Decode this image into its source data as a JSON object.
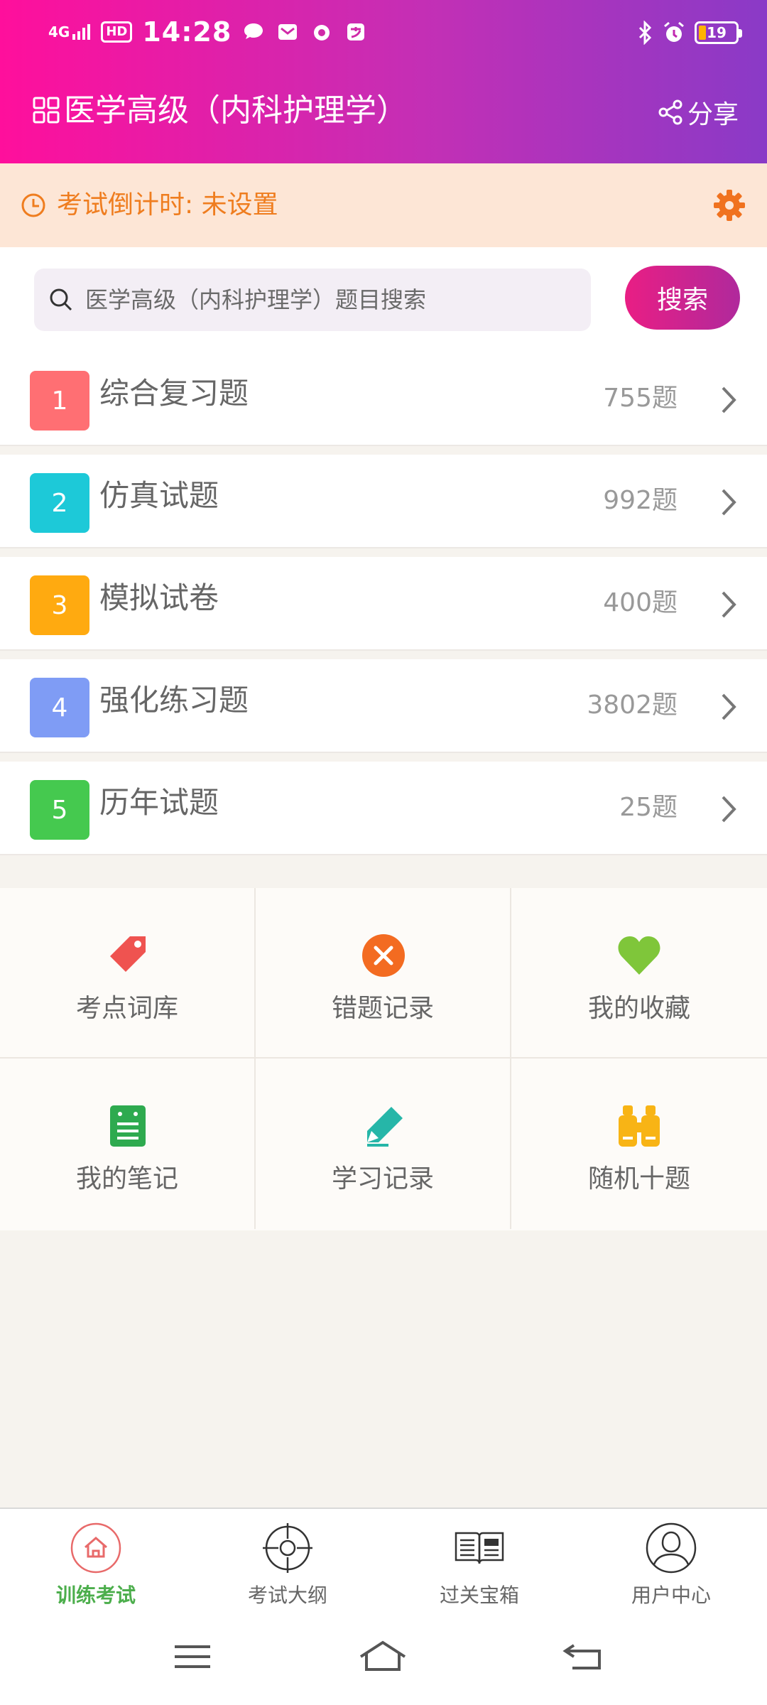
{
  "status_bar": {
    "network": "4G",
    "hd": "HD",
    "time": "14:28",
    "battery": "19"
  },
  "header": {
    "title": "医学高级（内科护理学）",
    "share_label": "分享"
  },
  "countdown": {
    "text": "考试倒计时: 未设置"
  },
  "search": {
    "placeholder": "医学高级（内科护理学）题目搜索",
    "button_label": "搜索"
  },
  "list": {
    "items": [
      {
        "index": "1",
        "label": "综合复习题",
        "count": "755题",
        "color": "#ff6f73"
      },
      {
        "index": "2",
        "label": "仿真试题",
        "count": "992题",
        "color": "#1dc9d8"
      },
      {
        "index": "3",
        "label": "模拟试卷",
        "count": "400题",
        "color": "#ffaa10"
      },
      {
        "index": "4",
        "label": "强化练习题",
        "count": "3802题",
        "color": "#7f9cf5"
      },
      {
        "index": "5",
        "label": "历年试题",
        "count": "25题",
        "color": "#45c94f"
      }
    ]
  },
  "tools": {
    "items": [
      {
        "label": "考点词库",
        "icon": "tag-icon"
      },
      {
        "label": "错题记录",
        "icon": "close-circle-icon"
      },
      {
        "label": "我的收藏",
        "icon": "heart-icon"
      },
      {
        "label": "我的笔记",
        "icon": "notebook-icon"
      },
      {
        "label": "学习记录",
        "icon": "pencil-icon"
      },
      {
        "label": "随机十题",
        "icon": "binoculars-icon"
      }
    ]
  },
  "tabs": {
    "items": [
      {
        "label": "训练考试",
        "icon": "home-icon",
        "active": true
      },
      {
        "label": "考试大纲",
        "icon": "target-icon",
        "active": false
      },
      {
        "label": "过关宝箱",
        "icon": "news-icon",
        "active": false
      },
      {
        "label": "用户中心",
        "icon": "user-icon",
        "active": false
      }
    ]
  },
  "colors": {
    "header_start": "#ff0f9c",
    "header_end": "#8a3ac7",
    "countdown_bg": "#fde6d6",
    "countdown_text": "#ef7d1f",
    "active_tab": "#4cae4c"
  }
}
